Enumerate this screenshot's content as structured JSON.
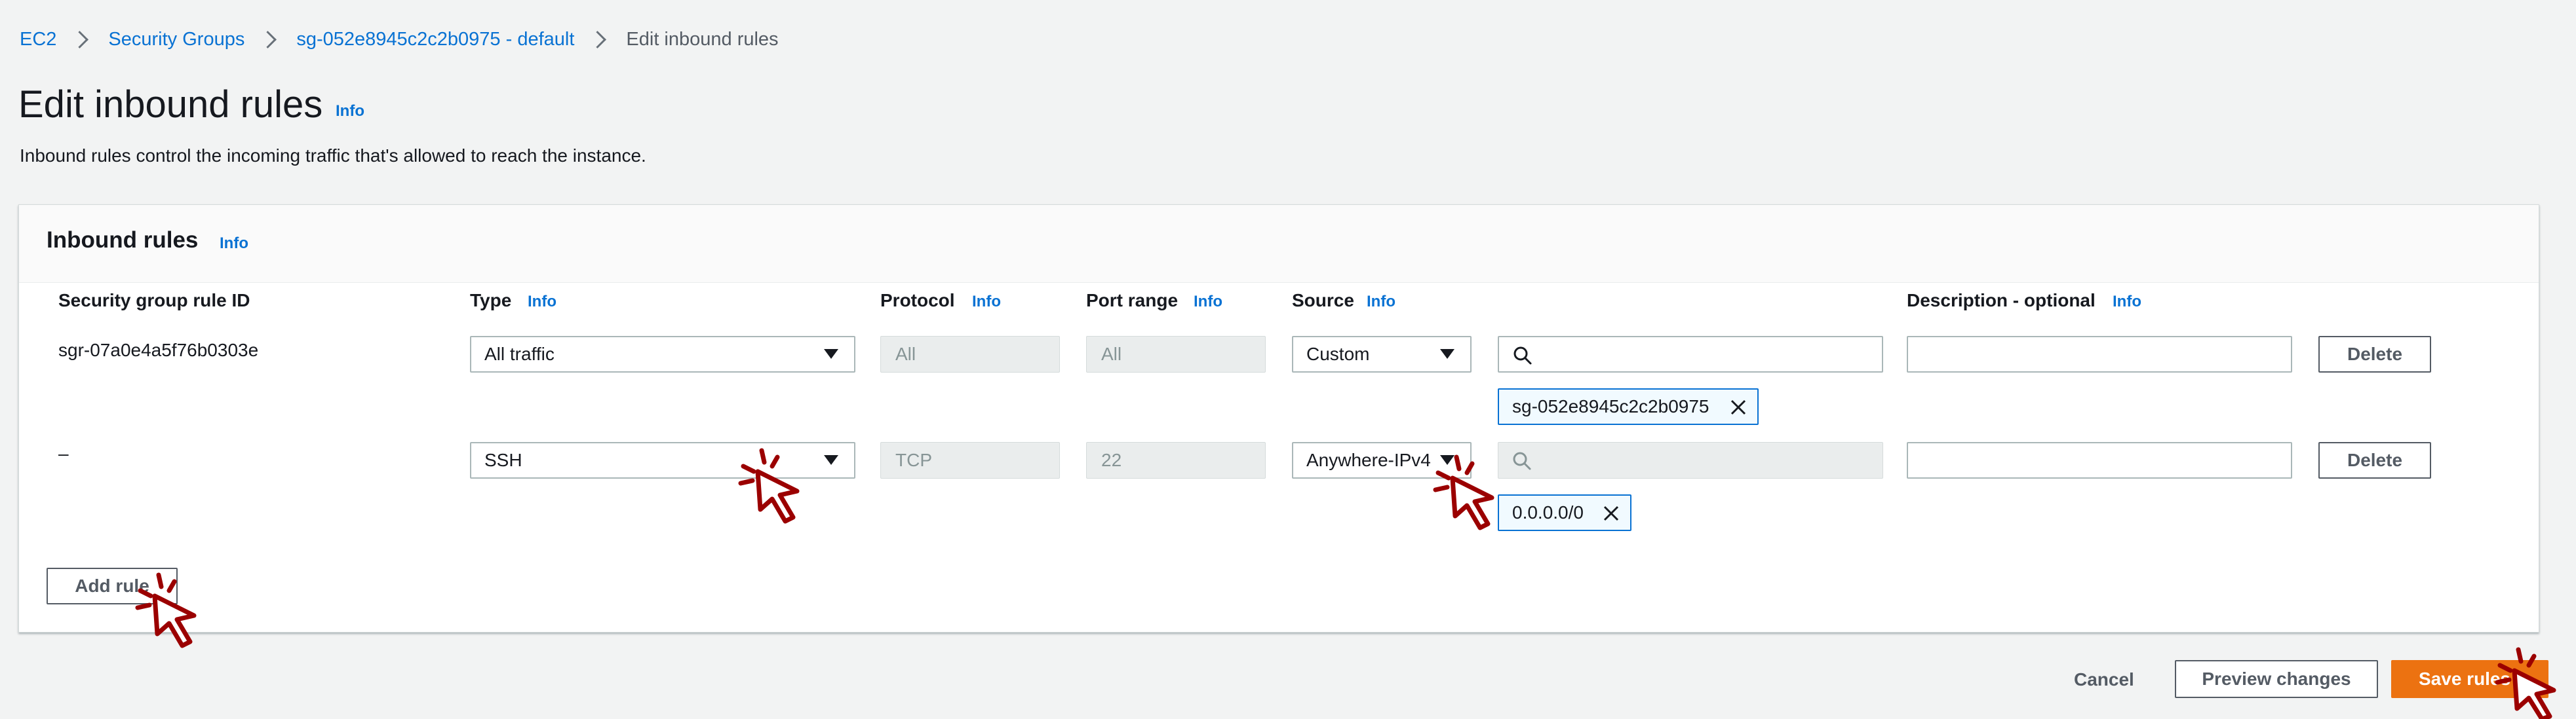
{
  "breadcrumb": {
    "items": [
      "EC2",
      "Security Groups",
      "sg-052e8945c2c2b0975 - default"
    ],
    "current": "Edit inbound rules"
  },
  "header": {
    "title": "Edit inbound rules",
    "info": "Info",
    "description": "Inbound rules control the incoming traffic that's allowed to reach the instance."
  },
  "inbound": {
    "title": "Inbound rules",
    "info": "Info",
    "columns": {
      "rule_id": "Security group rule ID",
      "type": "Type",
      "protocol": "Protocol",
      "port_range": "Port range",
      "source": "Source",
      "description": "Description - optional",
      "info": "Info"
    },
    "rows": [
      {
        "rule_id": "sgr-07a0e4a5f76b0303e",
        "type": "All traffic",
        "protocol": "All",
        "port_range": "All",
        "source": "Custom",
        "search_value": "",
        "token": "sg-052e8945c2c2b0975",
        "description": "",
        "delete": "Delete"
      },
      {
        "rule_id": "–",
        "type": "SSH",
        "protocol": "TCP",
        "port_range": "22",
        "source": "Anywhere-IPv4",
        "search_value": "",
        "token": "0.0.0.0/0",
        "description": "",
        "delete": "Delete"
      }
    ],
    "add_rule": "Add rule"
  },
  "footer": {
    "cancel": "Cancel",
    "preview": "Preview changes",
    "save": "Save rules"
  },
  "colors": {
    "link": "#0972d3",
    "primary": "#ec7211",
    "cursor": "#9b0000"
  }
}
